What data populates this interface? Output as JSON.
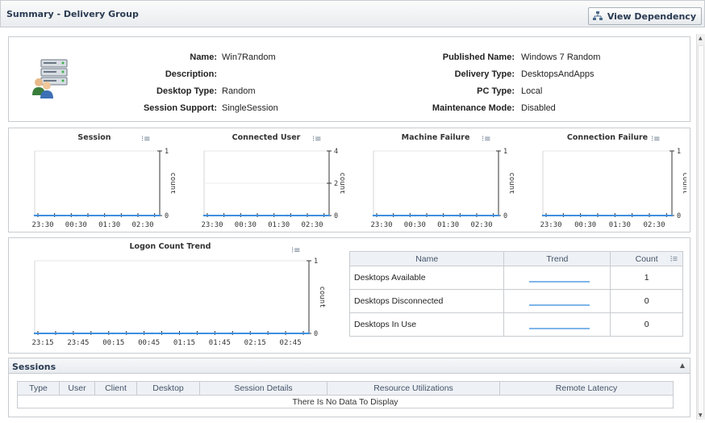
{
  "header": {
    "title": "Summary - Delivery Group",
    "view_dependency_label": "View Dependency"
  },
  "info": {
    "left": [
      {
        "label": "Name:",
        "value": "Win7Random"
      },
      {
        "label": "Description:",
        "value": ""
      },
      {
        "label": "Desktop Type:",
        "value": "Random"
      },
      {
        "label": "Session Support:",
        "value": "SingleSession"
      }
    ],
    "right": [
      {
        "label": "Published Name:",
        "value": "Windows 7 Random"
      },
      {
        "label": "Delivery Type:",
        "value": "DesktopsAndApps"
      },
      {
        "label": "PC Type:",
        "value": "Local"
      },
      {
        "label": "Maintenance Mode:",
        "value": "Disabled"
      }
    ]
  },
  "chart_data": [
    {
      "type": "line",
      "title": "Session",
      "x": [
        "23:30",
        "00:30",
        "01:30",
        "02:30"
      ],
      "series": [
        {
          "values": [
            0,
            0,
            0,
            0
          ]
        }
      ],
      "ylabel": "count",
      "ylim": [
        0,
        1
      ],
      "yticks": [
        "0",
        "1"
      ]
    },
    {
      "type": "line",
      "title": "Connected User",
      "x": [
        "23:30",
        "00:30",
        "01:30",
        "02:30"
      ],
      "series": [
        {
          "values": [
            0,
            0,
            0,
            0
          ]
        }
      ],
      "ylabel": "count",
      "ylim": [
        0,
        4
      ],
      "yticks": [
        "0",
        "2",
        "4"
      ]
    },
    {
      "type": "line",
      "title": "Machine Failure",
      "x": [
        "23:30",
        "00:30",
        "01:30",
        "02:30"
      ],
      "series": [
        {
          "values": [
            0,
            0,
            0,
            0
          ]
        }
      ],
      "ylabel": "count",
      "ylim": [
        0,
        1
      ],
      "yticks": [
        "0",
        "1"
      ]
    },
    {
      "type": "line",
      "title": "Connection Failure",
      "x": [
        "23:30",
        "00:30",
        "01:30",
        "02:30"
      ],
      "series": [
        {
          "values": [
            0,
            0,
            0,
            0
          ]
        }
      ],
      "ylabel": "count",
      "ylim": [
        0,
        1
      ],
      "yticks": [
        "0",
        "1"
      ]
    },
    {
      "type": "line",
      "title": "Logon Count Trend",
      "x": [
        "23:15",
        "23:45",
        "00:15",
        "00:45",
        "01:15",
        "01:45",
        "02:15",
        "02:45"
      ],
      "series": [
        {
          "values": [
            0,
            0,
            0,
            0,
            0,
            0,
            0,
            0
          ]
        }
      ],
      "ylabel": "count",
      "ylim": [
        0,
        1
      ],
      "yticks": [
        "0",
        "1"
      ]
    }
  ],
  "desktops_table": {
    "headers": [
      "Name",
      "Trend",
      "Count"
    ],
    "rows": [
      {
        "name": "Desktops Available",
        "count": "1"
      },
      {
        "name": "Desktops Disconnected",
        "count": "0"
      },
      {
        "name": "Desktops In Use",
        "count": "0"
      }
    ]
  },
  "sessions": {
    "title": "Sessions",
    "headers": [
      "Type",
      "User",
      "Client",
      "Desktop",
      "Session Details",
      "Resource Utilizations",
      "Remote Latency"
    ],
    "empty_message": "There Is No Data To Display"
  },
  "colors": {
    "line": "#3f8fdf",
    "header_text": "#2a3b52",
    "border": "#c8ccd0"
  }
}
